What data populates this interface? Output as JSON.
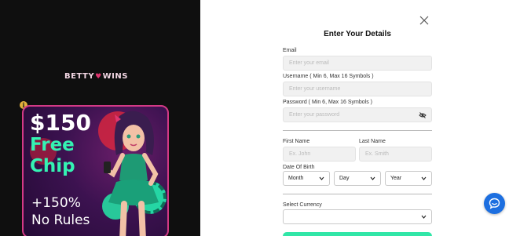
{
  "brand": {
    "logo_left": "BETTY",
    "logo_heart": "♥",
    "logo_right": "WINS"
  },
  "promo": {
    "amount": "$150",
    "free_line1": "Free",
    "free_line2": "Chip",
    "bonus_line1": "+150%",
    "bonus_line2": "No Rules"
  },
  "form": {
    "title": "Enter Your Details",
    "email": {
      "label": "Email",
      "placeholder": "Enter your email"
    },
    "username": {
      "label": "Username ( Min 6, Max 16 Symbols )",
      "placeholder": "Enter your username"
    },
    "password": {
      "label": "Password ( Min 6, Max 16 Symbols )",
      "placeholder": "Enter your password"
    },
    "first_name": {
      "label": "First Name",
      "placeholder": "Ex. John"
    },
    "last_name": {
      "label": "Last Name",
      "placeholder": "Ex. Smith"
    },
    "dob": {
      "label": "Date Of Birth",
      "month": "Month",
      "day": "Day",
      "year": "Year"
    },
    "currency": {
      "label": "Select Currency",
      "value": ""
    }
  },
  "colors": {
    "accent": "#31e6a7",
    "chat": "#1d6fe0",
    "promo_border": "#d33a86"
  },
  "icons": {
    "close": "close-icon",
    "password_toggle": "eye-off-icon",
    "chat": "chat-icon",
    "info": "info-icon"
  }
}
